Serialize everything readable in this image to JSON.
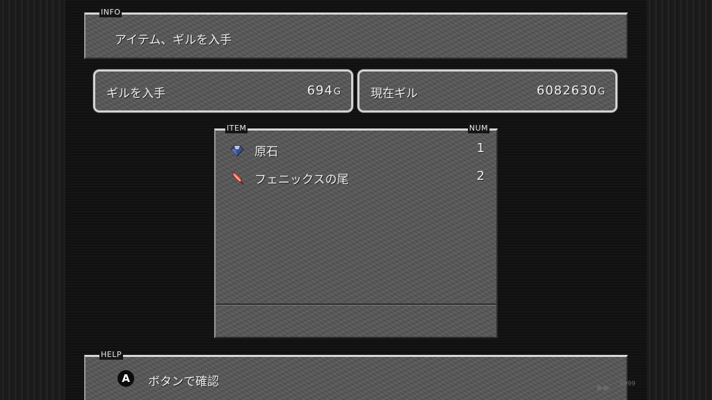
{
  "info": {
    "tag": "INFO",
    "message": "アイテム、ギルを入手"
  },
  "gil_obtained": {
    "label": "ギルを入手",
    "value": "694",
    "unit": "G"
  },
  "gil_current": {
    "label": "現在ギル",
    "value": "6082630",
    "unit": "G"
  },
  "items": {
    "header_item": "ITEM",
    "header_num": "NUM",
    "rows": [
      {
        "name": "原石",
        "num": "1",
        "icon": "gem-icon"
      },
      {
        "name": "フェニックスの尾",
        "num": "2",
        "icon": "phoenix-down-icon"
      }
    ]
  },
  "help": {
    "tag": "HELP",
    "button": "A",
    "message": "ボタンで確認"
  },
  "corner": {
    "fast_forward": "▶▶",
    "counter": "9999"
  },
  "colors": {
    "panel": "#575757",
    "border_light": "#d4d4d4",
    "background": "#141414"
  }
}
